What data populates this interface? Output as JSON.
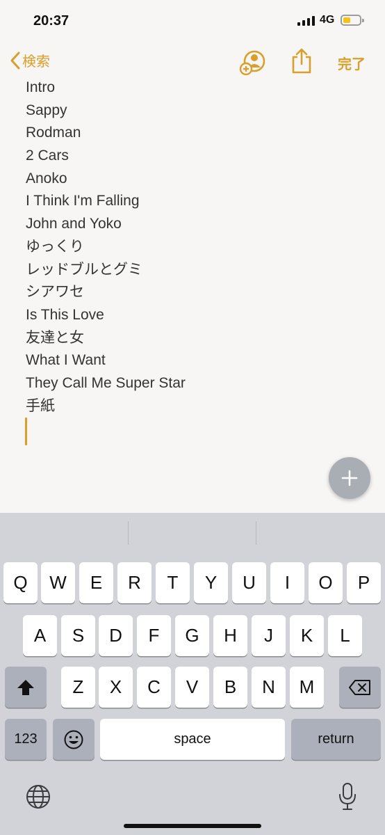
{
  "status": {
    "time": "20:37",
    "network": "4G",
    "battery_color": "#f3c316"
  },
  "nav": {
    "back_label": "検索",
    "done_label": "完了",
    "accent": "#d8a02a"
  },
  "note": {
    "lines": [
      "Intro",
      "Sappy",
      "Rodman",
      "2 Cars",
      "Anoko",
      "I Think I'm Falling",
      "John and Yoko",
      "ゆっくり",
      "レッドブルとグミ",
      "シアワセ",
      "Is This Love",
      "友達と女",
      "What I Want",
      "They Call Me Super Star",
      "手紙"
    ]
  },
  "keyboard": {
    "row1": [
      "Q",
      "W",
      "E",
      "R",
      "T",
      "Y",
      "U",
      "I",
      "O",
      "P"
    ],
    "row2": [
      "A",
      "S",
      "D",
      "F",
      "G",
      "H",
      "J",
      "K",
      "L"
    ],
    "row3": [
      "Z",
      "X",
      "C",
      "V",
      "B",
      "N",
      "M"
    ],
    "numbers_label": "123",
    "space_label": "space",
    "return_label": "return",
    "icons": [
      "shift-icon",
      "backspace-icon",
      "emoji-icon",
      "globe-icon",
      "microphone-icon"
    ]
  }
}
